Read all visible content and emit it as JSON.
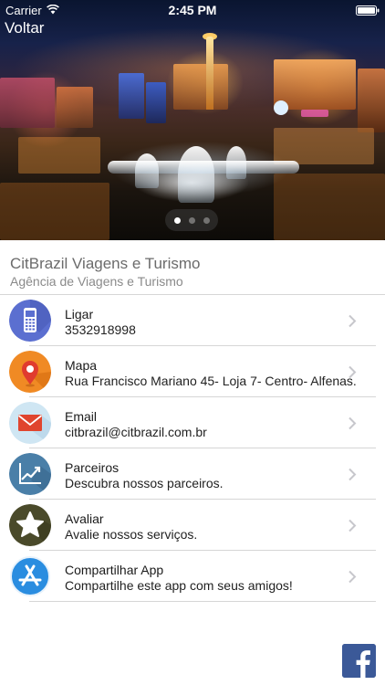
{
  "status_bar": {
    "carrier": "Carrier",
    "time": "2:45 PM"
  },
  "nav": {
    "back_label": "Voltar"
  },
  "carousel": {
    "page_count": 3,
    "active_page": 1
  },
  "company": {
    "name": "CitBrazil Viagens e Turismo",
    "subtitle": "Agência de Viagens e Turismo"
  },
  "menu": [
    {
      "title": "Ligar",
      "detail": "3532918998",
      "icon": "phone-icon",
      "color": "#5b6fd0"
    },
    {
      "title": "Mapa",
      "detail": "Rua Francisco Mariano 45- Loja 7- Centro- Alfenas.",
      "icon": "map-pin-icon",
      "color": "#f08a24"
    },
    {
      "title": "Email",
      "detail": "citbrazil@citbrazil.com.br",
      "icon": "envelope-icon",
      "color": "#cfe6f3"
    },
    {
      "title": "Parceiros",
      "detail": "Descubra nossos parceiros.",
      "icon": "chart-icon",
      "color": "#4a7fa8"
    },
    {
      "title": "Avaliar",
      "detail": "Avalie nossos serviços.",
      "icon": "star-icon",
      "color": "#4a4a2a"
    },
    {
      "title": "Compartilhar App",
      "detail": "Compartilhe este app com seus amigos!",
      "icon": "app-store-icon",
      "color": "#2a8de0"
    }
  ],
  "social": {
    "icon": "facebook-icon",
    "color": "#3b5998"
  }
}
